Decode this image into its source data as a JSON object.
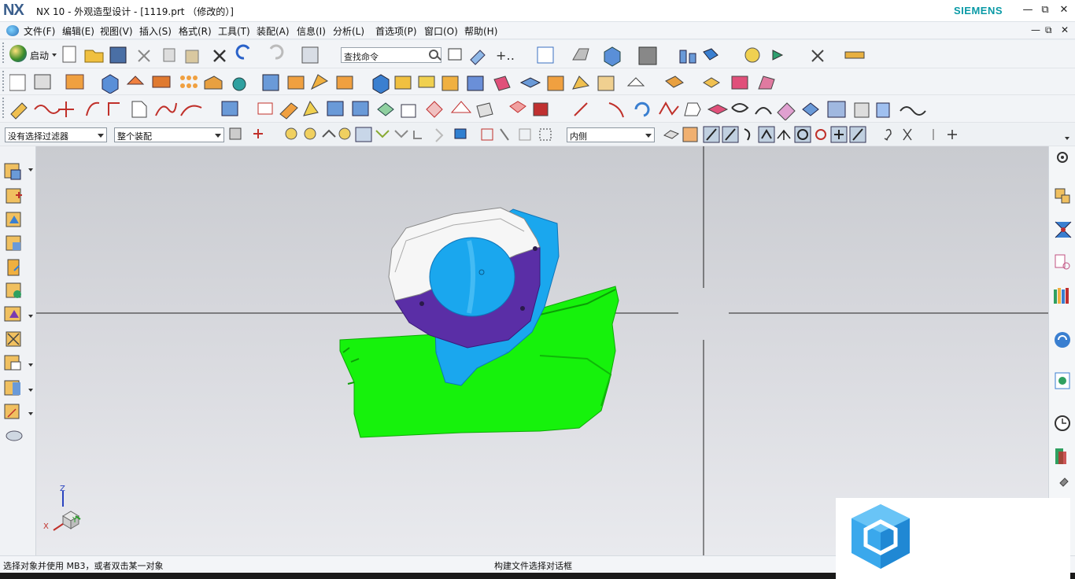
{
  "window": {
    "logo": "NX",
    "title": "NX 10 - 外观造型设计 - [1119.prt （修改的）]",
    "brand": "SIEMENS",
    "minimize": "—",
    "restore": "⧉",
    "close": "✕"
  },
  "menu": {
    "items": [
      "文件(F)",
      "编辑(E)",
      "视图(V)",
      "插入(S)",
      "格式(R)",
      "工具(T)",
      "装配(A)",
      "信息(I)",
      "分析(L)",
      "首选项(P)",
      "窗口(O)",
      "帮助(H)"
    ],
    "doc_minimize": "—",
    "doc_restore": "⧉",
    "doc_close": "✕"
  },
  "toolbar": {
    "start_label": "启动",
    "command_search_placeholder": "查找命令",
    "selection_filter": "没有选择过滤器",
    "assembly_scope": "整个装配",
    "selection_mode": "内侧"
  },
  "status": {
    "prompt": "选择对象并使用 MB3，或者双击某一对象",
    "message": "构建文件选择对话框"
  },
  "triad": {
    "x": "X",
    "y": "Y",
    "z": "Z"
  },
  "colors": {
    "accent": "#0a9aa6",
    "model_green": "#16f20c",
    "model_blue": "#1aa7ee",
    "model_purple": "#5a2ea6",
    "model_white": "#f6f6f6"
  }
}
